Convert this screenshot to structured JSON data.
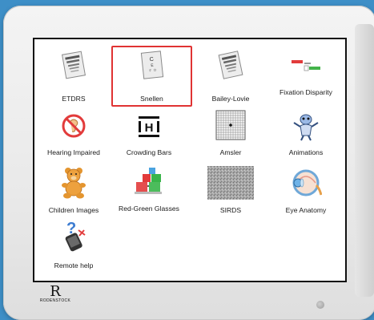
{
  "tiles": [
    {
      "label": "ETDRS",
      "icon": "etdrs-chart-icon"
    },
    {
      "label": "Snellen",
      "icon": "snellen-chart-icon",
      "selected": true
    },
    {
      "label": "Bailey-Lovie",
      "icon": "bailey-lovie-chart-icon"
    },
    {
      "label": "Fixation Disparity",
      "icon": "fixation-disparity-icon"
    },
    {
      "label": "Hearing Impaired",
      "icon": "hearing-impaired-icon"
    },
    {
      "label": "Crowding Bars",
      "icon": "crowding-bars-icon"
    },
    {
      "label": "Amsler",
      "icon": "amsler-grid-icon"
    },
    {
      "label": "Animations",
      "icon": "animations-icon"
    },
    {
      "label": "Children Images",
      "icon": "teddy-bear-icon"
    },
    {
      "label": "Red-Green Glasses",
      "icon": "red-green-glasses-icon"
    },
    {
      "label": "SIRDS",
      "icon": "sirds-noise-icon"
    },
    {
      "label": "Eye Anatomy",
      "icon": "eye-anatomy-icon"
    },
    {
      "label": "Remote help",
      "icon": "remote-help-icon"
    }
  ],
  "snellen_letters": [
    "C",
    "E",
    "F",
    "D"
  ],
  "crowding_letter": "H",
  "brand": "RODENSTOCK",
  "colors": {
    "selection": "#e03333",
    "background": "#3e8fc7"
  }
}
